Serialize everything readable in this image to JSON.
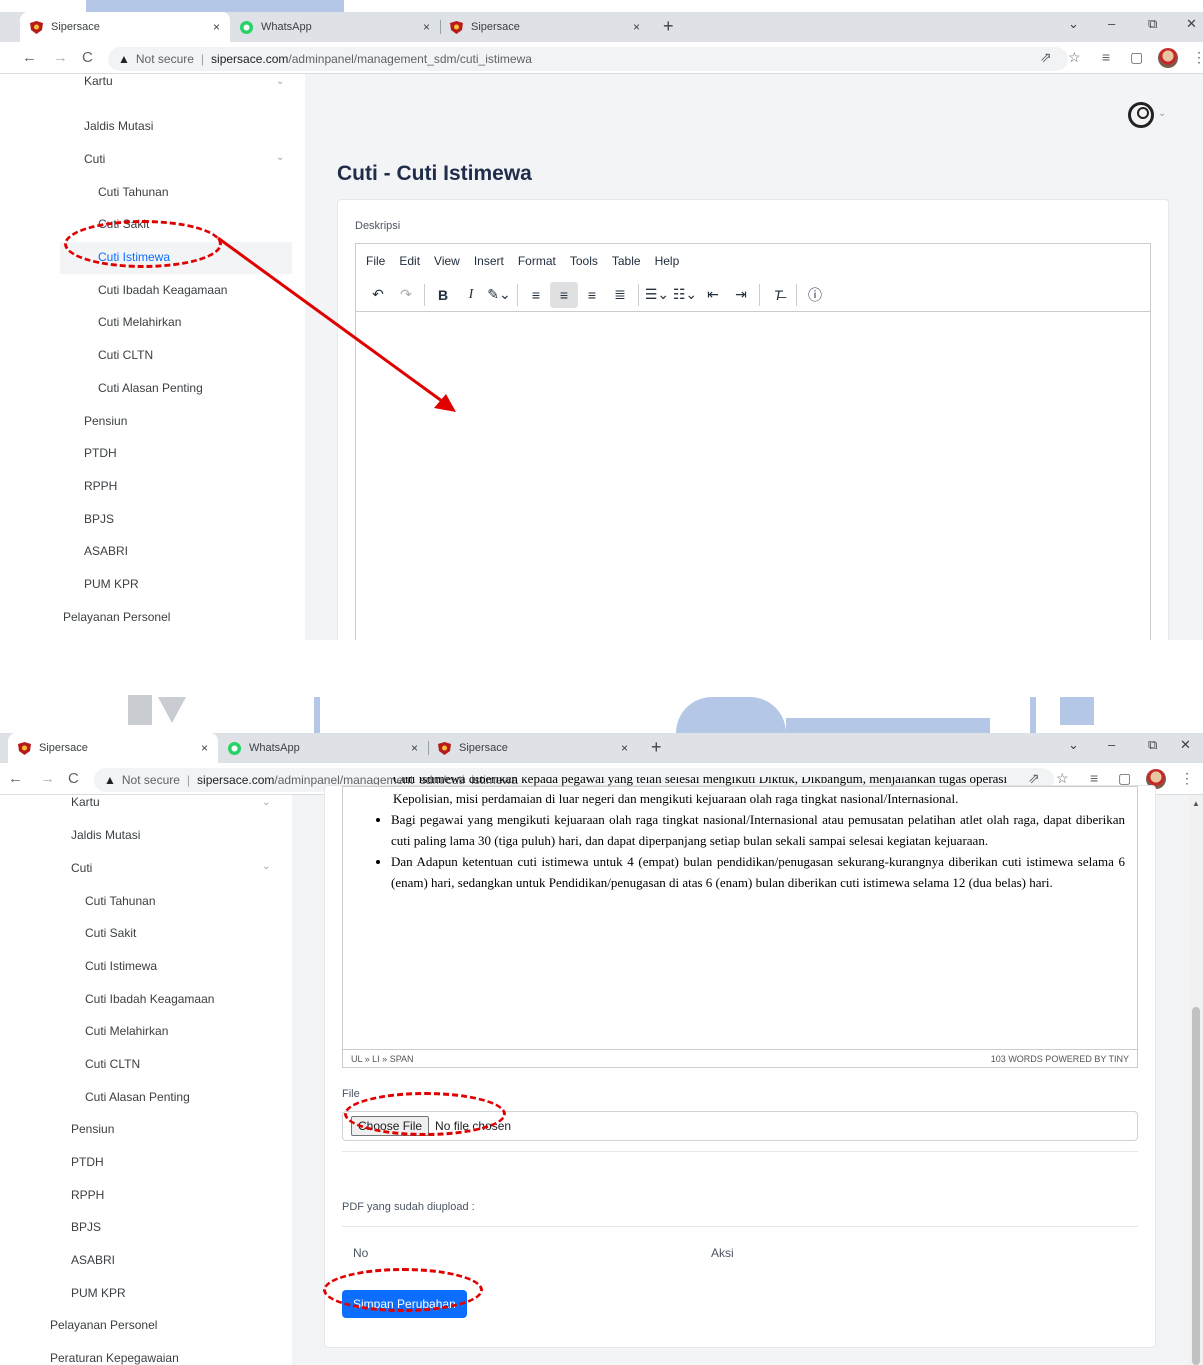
{
  "browser": {
    "tabs": [
      {
        "title": "Sipersace",
        "close": "×"
      },
      {
        "title": "WhatsApp",
        "close": "×"
      },
      {
        "title": "Sipersace",
        "close": "×"
      }
    ],
    "new_tab": "+",
    "window_controls": {
      "dropdown": "⌄",
      "minimize": "–",
      "restore": "⧉",
      "close": "✕"
    },
    "nav": {
      "back": "←",
      "forward": "→",
      "reload": "C"
    },
    "security_text": "Not secure",
    "url_host": "sipersace.com",
    "url_path": "/adminpanel/management_sdm/cuti_istimewa"
  },
  "sidebar": {
    "items": [
      {
        "label": "Kartu"
      },
      {
        "label": "Jaldis Mutasi"
      },
      {
        "label": "Cuti"
      },
      {
        "label": "Cuti Tahunan"
      },
      {
        "label": "Cuti Sakit"
      },
      {
        "label": "Cuti Istimewa"
      },
      {
        "label": "Cuti Ibadah Keagamaan"
      },
      {
        "label": "Cuti Melahirkan"
      },
      {
        "label": "Cuti CLTN"
      },
      {
        "label": "Cuti Alasan Penting"
      },
      {
        "label": "Pensiun"
      },
      {
        "label": "PTDH"
      },
      {
        "label": "RPPH"
      },
      {
        "label": "BPJS"
      },
      {
        "label": "ASABRI"
      },
      {
        "label": "PUM KPR"
      },
      {
        "label": "Pelayanan Personel"
      },
      {
        "label": "Peraturan Kepegawaian"
      }
    ]
  },
  "page": {
    "title": "Cuti - Cuti Istimewa",
    "description_label": "Deskripsi"
  },
  "editor": {
    "menu": [
      "File",
      "Edit",
      "View",
      "Insert",
      "Format",
      "Tools",
      "Table",
      "Help"
    ],
    "content_partial_top": "Cuti istimewa diberikan kepada pegawai yang telah selesai mengikuti Diktuk, Dikbangum, menjalankan tugas operasi",
    "content_line2": "Kepolisian, misi perdamaian di luar negeri dan mengikuti kejuaraan olah raga tingkat nasional/Internasional.",
    "bullet1": "Bagi pegawai yang mengikuti kejuaraan olah raga tingkat nasional/Internasional atau pemusatan pelatihan atlet olah raga, dapat diberikan cuti paling lama 30 (tiga puluh) hari, dan dapat diperpanjang setiap  bulan sekali sampai selesai kegiatan kejuaraan.",
    "bullet2": "Dan Adapun ketentuan cuti istimewa untuk 4 (empat) bulan pendidikan/penugasan sekurang-kurangnya diberikan cuti istimewa selama 6 (enam) hari, sedangkan untuk Pendidikan/penugasan di atas 6 (enam) bulan diberikan cuti istimewa selama 12 (dua belas) hari.",
    "status_path": "UL » LI » SPAN",
    "status_words": "103 WORDS  POWERED BY TINY"
  },
  "file": {
    "label": "File",
    "choose_button": "Choose File",
    "no_file_text": "No file chosen"
  },
  "uploaded": {
    "label": "PDF yang sudah diupload :",
    "col_no": "No",
    "col_aksi": "Aksi"
  },
  "save_button": "Simpan Perubahan",
  "annotation_color": "#e00000",
  "accent_color": "#0d6efd"
}
